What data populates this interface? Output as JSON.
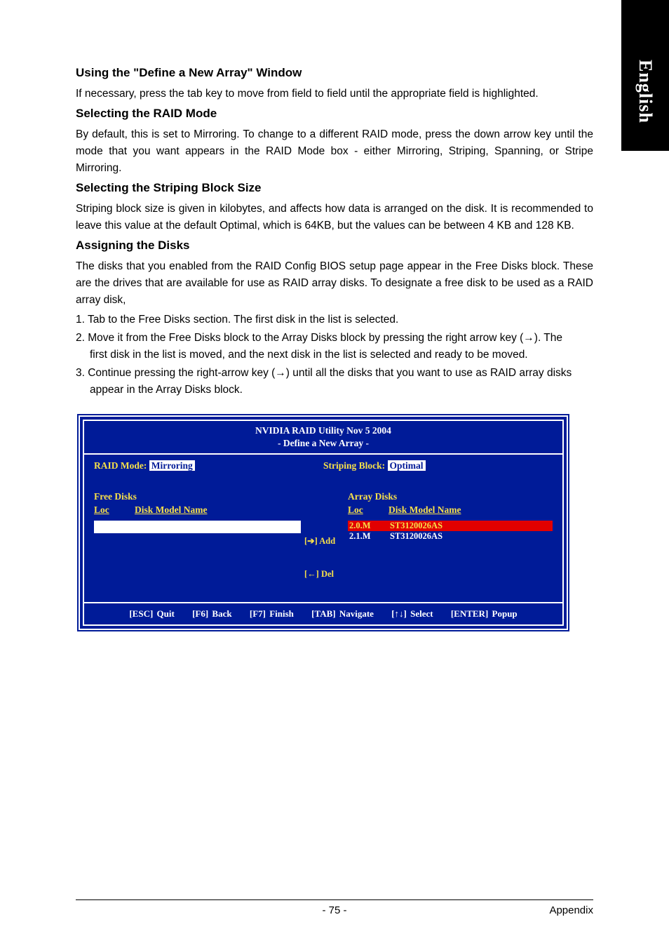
{
  "side_tab": "English",
  "sections": {
    "s1_h": "Using the \"Define a New Array\" Window",
    "s1_p": "If necessary, press the tab key to move from field to field until the appropriate field is highlighted.",
    "s2_h": "Selecting the RAID Mode",
    "s2_p": "By default, this is set to Mirroring. To change to a different RAID mode, press the down arrow key until the mode that you want appears in the RAID Mode box - either Mirroring, Striping, Spanning, or Stripe Mirroring.",
    "s3_h": "Selecting the Striping Block Size",
    "s3_p": "Striping block size is given in kilobytes, and affects how data is arranged on the disk. It is recommended to leave this value at the default Optimal, which is 64KB, but the values can be between 4 KB and 128 KB.",
    "s4_h": "Assigning the Disks",
    "s4_p": "The disks that you enabled from the RAID Config BIOS setup page appear in the Free Disks block. These are the drives that are available for use as RAID array disks. To designate a free disk to be used as a RAID array disk,",
    "li1": "1. Tab to the Free Disks section. The first disk in the list is selected.",
    "li2a": "2. Move it from the Free Disks block to the Array Disks block by pressing the right arrow key (→). The",
    "li2b": "first disk in the list is moved, and the next disk in the list is selected and ready to be moved.",
    "li3a": "3. Continue pressing the right-arrow key (→) until all the disks that you want to use as RAID array disks",
    "li3b": "appear in the Array Disks block."
  },
  "bios": {
    "title_line1": "NVIDIA RAID Utility  Nov 5 2004",
    "title_line2": "- Define a New Array -",
    "raid_mode_label": "RAID Mode:",
    "raid_mode_value": "Mirroring",
    "striping_label": "Striping Block:",
    "striping_value": "Optimal",
    "free_disks_label": "Free Disks",
    "array_disks_label": "Array Disks",
    "loc_label": "Loc",
    "model_label": "Disk Model Name",
    "add_label": "[➔] Add",
    "del_label": "[←] Del",
    "array_rows": [
      {
        "loc": "2.0.M",
        "model": "ST3120026AS",
        "selected": true
      },
      {
        "loc": "2.1.M",
        "model": "ST3120026AS",
        "selected": false
      }
    ],
    "footer": {
      "esc": "[ESC] Quit",
      "f6": "[F6] Back",
      "f7": "[F7] Finish",
      "tab": "[TAB] Navigate",
      "arrows": "[↑↓] Select",
      "enter": "[ENTER] Popup"
    }
  },
  "page_footer": {
    "page_number": "- 75 -",
    "section": "Appendix"
  }
}
